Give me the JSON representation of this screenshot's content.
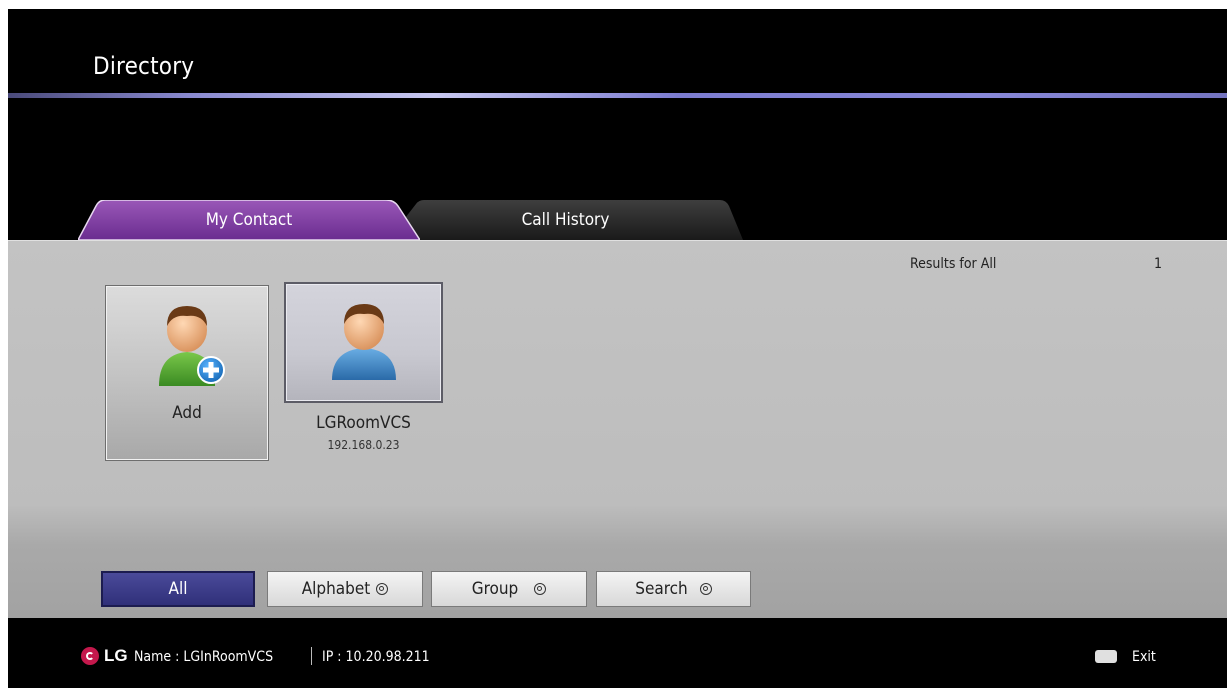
{
  "header": {
    "title": "Directory"
  },
  "tabs": [
    {
      "label": "My Contact",
      "active": true
    },
    {
      "label": "Call History",
      "active": false
    }
  ],
  "results": {
    "label": "Results for All",
    "count": "1"
  },
  "add_card": {
    "label": "Add",
    "icon": "add-user-icon"
  },
  "contacts": [
    {
      "name": "LGRoomVCS",
      "ip": "192.168.0.23",
      "icon": "user-avatar-icon"
    }
  ],
  "filters": [
    {
      "label": "All",
      "active": true
    },
    {
      "label": "Alphabet",
      "icon": "dial-icon"
    },
    {
      "label": "Group",
      "icon": "dial-icon"
    },
    {
      "label": "Search",
      "icon": "dial-icon"
    }
  ],
  "status_bar": {
    "logo_text": "LG",
    "name_text": "Name : LGInRoomVCS",
    "ip_text": "IP : 10.20.98.211",
    "exit_label": "Exit"
  },
  "colors": {
    "accent_purple": "#7a3fa0",
    "tab_inactive": "#2a2a2a",
    "button_active": "#30307a",
    "lg_red": "#c4184c"
  }
}
